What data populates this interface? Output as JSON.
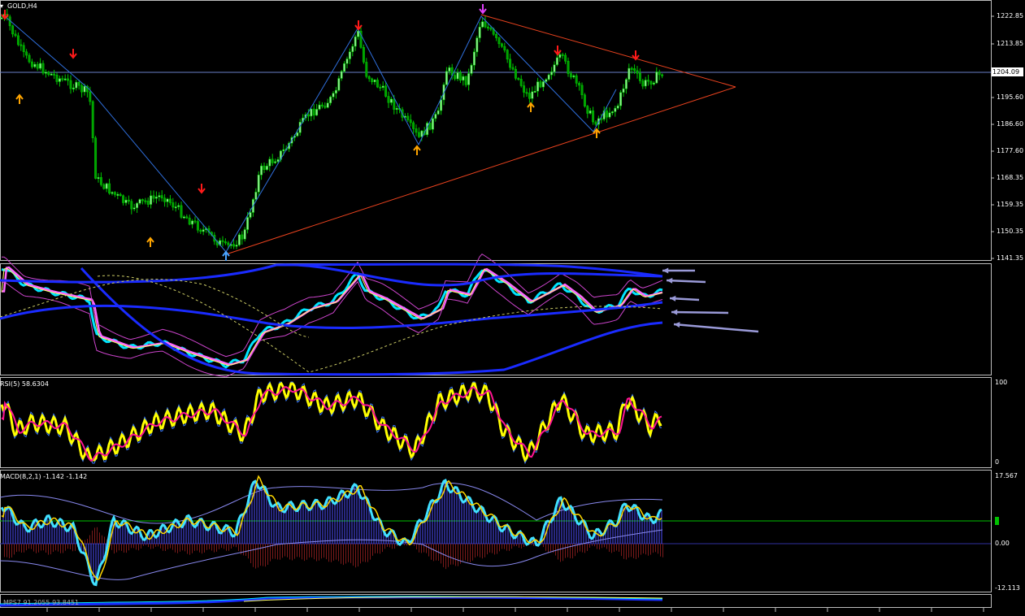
{
  "window": {
    "symbol_label": "GOLD,H4"
  },
  "price_axis": {
    "ticks": [
      "1222.85",
      "1213.85",
      "1204.09",
      "1195.60",
      "1186.60",
      "1177.60",
      "1168.35",
      "1159.35",
      "1150.35",
      "1141.35"
    ],
    "current_price": "1204.09",
    "current_price_value": 1204.09
  },
  "rsi": {
    "label": "RSI(5) 58.6304",
    "scale_top": "100",
    "scale_bottom": "0"
  },
  "macd": {
    "label": "MACD(8,2,1) -1.142 -1.142",
    "scale_top": "17.567",
    "scale_mid": "0.00",
    "scale_bottom": "-12.113"
  },
  "bottom_indicator": {
    "label": "MPS7 91.2055 93.8451"
  },
  "colors": {
    "background": "#000000",
    "bull_candle": "#00c800",
    "current_price_line": "#6a7fc8",
    "zigzag": "#2f6fdc",
    "trendline": "#e8421e",
    "arrow_up": "#ffa500",
    "arrow_down": "#ff1a1a",
    "arrow_special": "#e040fb",
    "annotation_arrow": "#9a9ad8",
    "rsi_main": "#ffff00",
    "rsi_signal": "#ff1493",
    "macd_main": "#40e0ff",
    "macd_signal": "#ffd700",
    "macd_zero": "#00ff00"
  },
  "chart_data": {
    "type": "candlestick",
    "zigzag_prices": [
      1222,
      1146,
      1208,
      1166,
      1219,
      1192,
      1208
    ],
    "price_range": [
      1141.35,
      1226
    ]
  }
}
